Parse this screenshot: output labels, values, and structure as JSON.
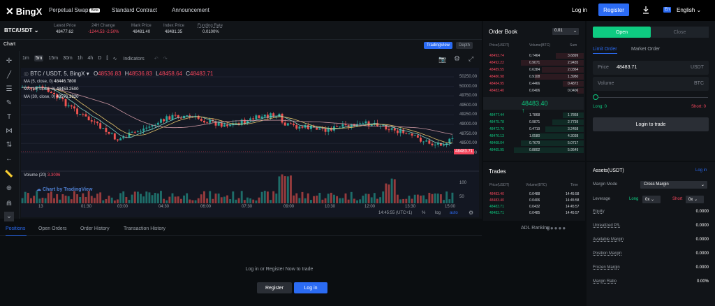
{
  "nav": {
    "logo": "BingX",
    "links": [
      "Perpetual Swap",
      "Standard Contract",
      "Announcement"
    ],
    "beta": "Beta",
    "login": "Log in",
    "register": "Register",
    "lang_badge": "En",
    "lang": "English"
  },
  "ticker": {
    "pair": "BTC/USDT",
    "items": [
      {
        "label": "Latest Price",
        "value": "48477.62"
      },
      {
        "label": "24H Change",
        "value": "-1244.53  -2.50%"
      },
      {
        "label": "Mark Price",
        "value": "48481.40"
      },
      {
        "label": "Index Price",
        "value": "48481.35"
      },
      {
        "label": "Funding Rate",
        "value": "0.0100%"
      }
    ]
  },
  "chart": {
    "title": "Chart",
    "intervals": [
      "1m",
      "5m",
      "15m",
      "30m",
      "1h",
      "4h",
      "D"
    ],
    "active_interval": "5m",
    "indicators": "Indicators",
    "tv_button": "TradingView",
    "depth_button": "Depth",
    "symbol_line": "BTC / USDT, 5, BingX",
    "ohlc": {
      "o": "48536.83",
      "h": "48536.83",
      "l": "48458.64",
      "c": "48483.71"
    },
    "ma_lines": [
      {
        "label": "MA (5, close, 0)",
        "value": "48446.7800"
      },
      {
        "label": "MA (10, close, 0)",
        "value": "48453.2500"
      },
      {
        "label": "MA (30, close, 0)",
        "value": "48576.3920"
      }
    ],
    "volume_label": "Volume (20)",
    "volume_value": "3.3096",
    "watermark": "Chart by TradingView",
    "price_axis": [
      "50250.00",
      "50000.00",
      "49750.00",
      "49500.00",
      "49250.00",
      "49000.00",
      "48750.00",
      "48500.00",
      "48250.00"
    ],
    "current_price": "48483.71",
    "vol_axis": [
      "100",
      "50"
    ],
    "time_axis": [
      "13",
      "01:30",
      "03:00",
      "04:30",
      "06:00",
      "07:30",
      "09:00",
      "10:30",
      "12:00",
      "13:30",
      "15:00"
    ],
    "clock": "14:45:55 (UTC+1)",
    "pct": "%",
    "log": "log",
    "auto": "auto"
  },
  "bottom": {
    "tabs": [
      "Positions",
      "Open Orders",
      "Order History",
      "Transaction History"
    ],
    "adl": "ADL Ranking",
    "empty": "Log in or Register Now to trade",
    "register": "Register",
    "login": "Log in"
  },
  "orderbook": {
    "title": "Order Book",
    "precision": "0.01",
    "headers": [
      "Price(USDT)",
      "Volume(BTC)",
      "Sum"
    ],
    "asks": [
      [
        "48493.74",
        "0.7464",
        "3.6899"
      ],
      [
        "48492.22",
        "0.9071",
        "2.9435"
      ],
      [
        "48489.55",
        "0.6384",
        "2.0364"
      ],
      [
        "48486.98",
        "0.9108",
        "1.3980"
      ],
      [
        "48484.95",
        "0.4466",
        "0.4872"
      ],
      [
        "48483.40",
        "0.0406",
        "0.0406"
      ]
    ],
    "mid": "48483.40 ↑",
    "bids": [
      [
        "48477.44",
        "1.7868",
        "1.7868"
      ],
      [
        "48475.78",
        "0.9871",
        "2.7739"
      ],
      [
        "48472.76",
        "0.4719",
        "3.2458"
      ],
      [
        "48470.13",
        "1.0580",
        "4.3038"
      ],
      [
        "48468.04",
        "0.7679",
        "5.0717"
      ],
      [
        "48465.95",
        "0.8802",
        "5.9549"
      ]
    ]
  },
  "trades": {
    "title": "Trades",
    "headers": [
      "Price(USDT)",
      "Volume(BTC)",
      "Time"
    ],
    "rows": [
      [
        "48483.40",
        "0.0488",
        "14:45:58"
      ],
      [
        "48483.40",
        "0.0406",
        "14:45:58"
      ],
      [
        "48483.71",
        "0.0432",
        "14:45:57"
      ],
      [
        "48483.71",
        "0.0485",
        "14:45:57"
      ]
    ]
  },
  "order": {
    "open": "Open",
    "close": "Close",
    "tabs": [
      "Limit Order",
      "Market Order"
    ],
    "price_label": "Price",
    "price_value": "48483.71",
    "price_unit": "USDT",
    "volume_label": "Volume",
    "volume_unit": "BTC",
    "long": "Long: 0",
    "short": "Short: 0",
    "login_to_trade": "Login to trade"
  },
  "assets": {
    "title": "Assets(USDT)",
    "login": "Log in",
    "margin_mode_label": "Margin Mode",
    "margin_mode": "Cross Margin",
    "leverage_label": "Leverage",
    "long": "Long",
    "short": "Short",
    "lev_long": "0x",
    "lev_short": "0x",
    "rows": [
      {
        "label": "Equity",
        "value": "0.0000"
      },
      {
        "label": "Unrealized P/L",
        "value": "0.0000"
      },
      {
        "label": "Available Margin",
        "value": "0.0000"
      },
      {
        "label": "Position Margin",
        "value": "0.0000"
      },
      {
        "label": "Frozen Margin",
        "value": "0.0000"
      },
      {
        "label": "Margin Ratio",
        "value": "0.00%"
      }
    ]
  }
}
